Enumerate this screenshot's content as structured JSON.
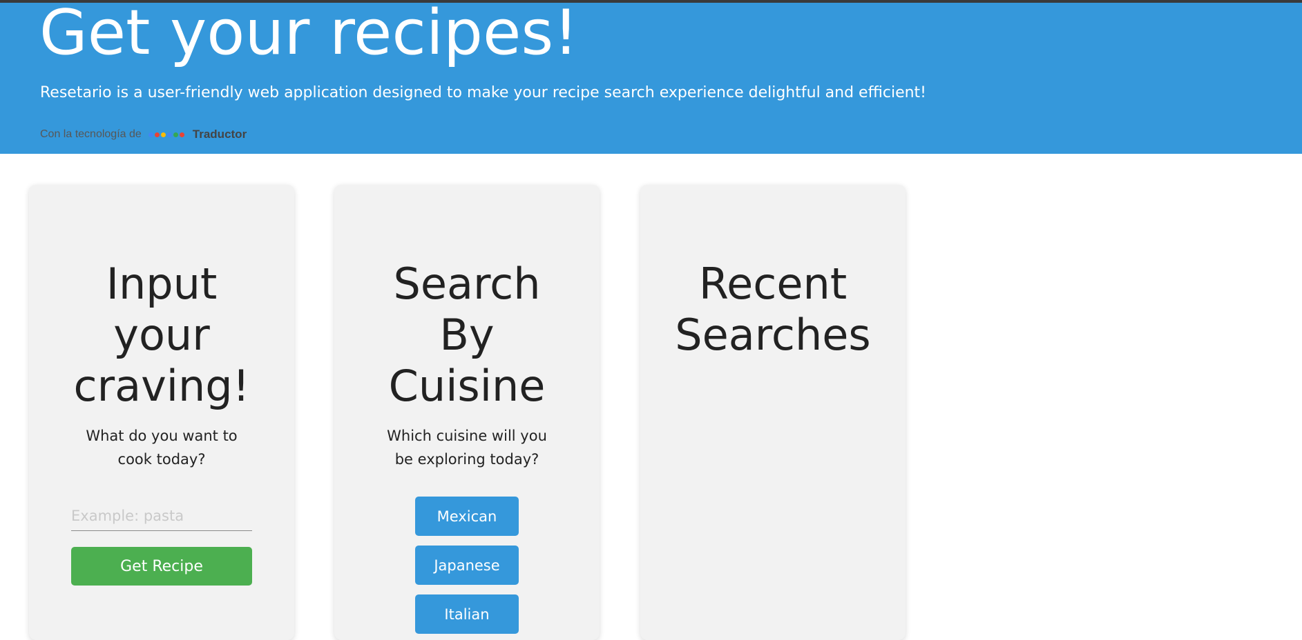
{
  "header": {
    "title": "Get your recipes!",
    "subtitle": "Resetario is a user-friendly web application designed to make your recipe search experience delightful and efficient!",
    "powered_by": "Con la tecnología de",
    "translate_label": "Traductor",
    "logo_letters": [
      "G",
      "o",
      "o",
      "g",
      "l",
      "e"
    ]
  },
  "cards": {
    "craving": {
      "title": "Input your craving!",
      "description": "What do you want to cook today?",
      "input_placeholder": "Example: pasta",
      "input_value": "",
      "button_label": "Get Recipe"
    },
    "cuisine": {
      "title": "Search By Cuisine",
      "description": "Which cuisine will you be exploring today?",
      "buttons": [
        "Mexican",
        "Japanese",
        "Italian"
      ]
    },
    "recent": {
      "title": "Recent Searches"
    }
  },
  "colors": {
    "header_bg": "#3598db",
    "card_bg": "#f2f2f2",
    "primary_button": "#4caf50",
    "cuisine_button": "#3598db"
  }
}
